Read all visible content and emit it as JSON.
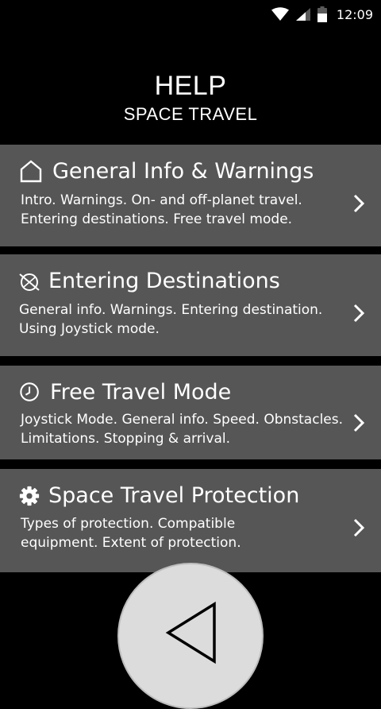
{
  "status_bar": {
    "time": "12:09",
    "icons": [
      "wifi-icon",
      "signal-icon",
      "battery-icon"
    ]
  },
  "header": {
    "title": "HELP",
    "subtitle": "SPACE TRAVEL"
  },
  "cards": [
    {
      "title": "General Info & Warnings",
      "description": "Intro. Warnings. On- and off-planet travel. Entering destinations. Free travel mode.",
      "icon": "home-icon"
    },
    {
      "title": "Entering Destinations",
      "description": "General info. Warnings. Entering destination. Using Joystick mode.",
      "icon": "planet-icon"
    },
    {
      "title": "Free Travel Mode",
      "description": "Joystick Mode. General info. Speed. Obnstacles. Limitations. Stopping & arrival.",
      "icon": "clock-icon"
    },
    {
      "title": "Space Travel Protection",
      "description": "Types of protection. Compatible equipment. Extent of protection.",
      "icon": "gear-icon"
    }
  ],
  "back_button": {
    "icon": "back-triangle-icon"
  },
  "colors": {
    "background": "#000000",
    "card": "#565656",
    "back_button": "#dcdcdc"
  }
}
